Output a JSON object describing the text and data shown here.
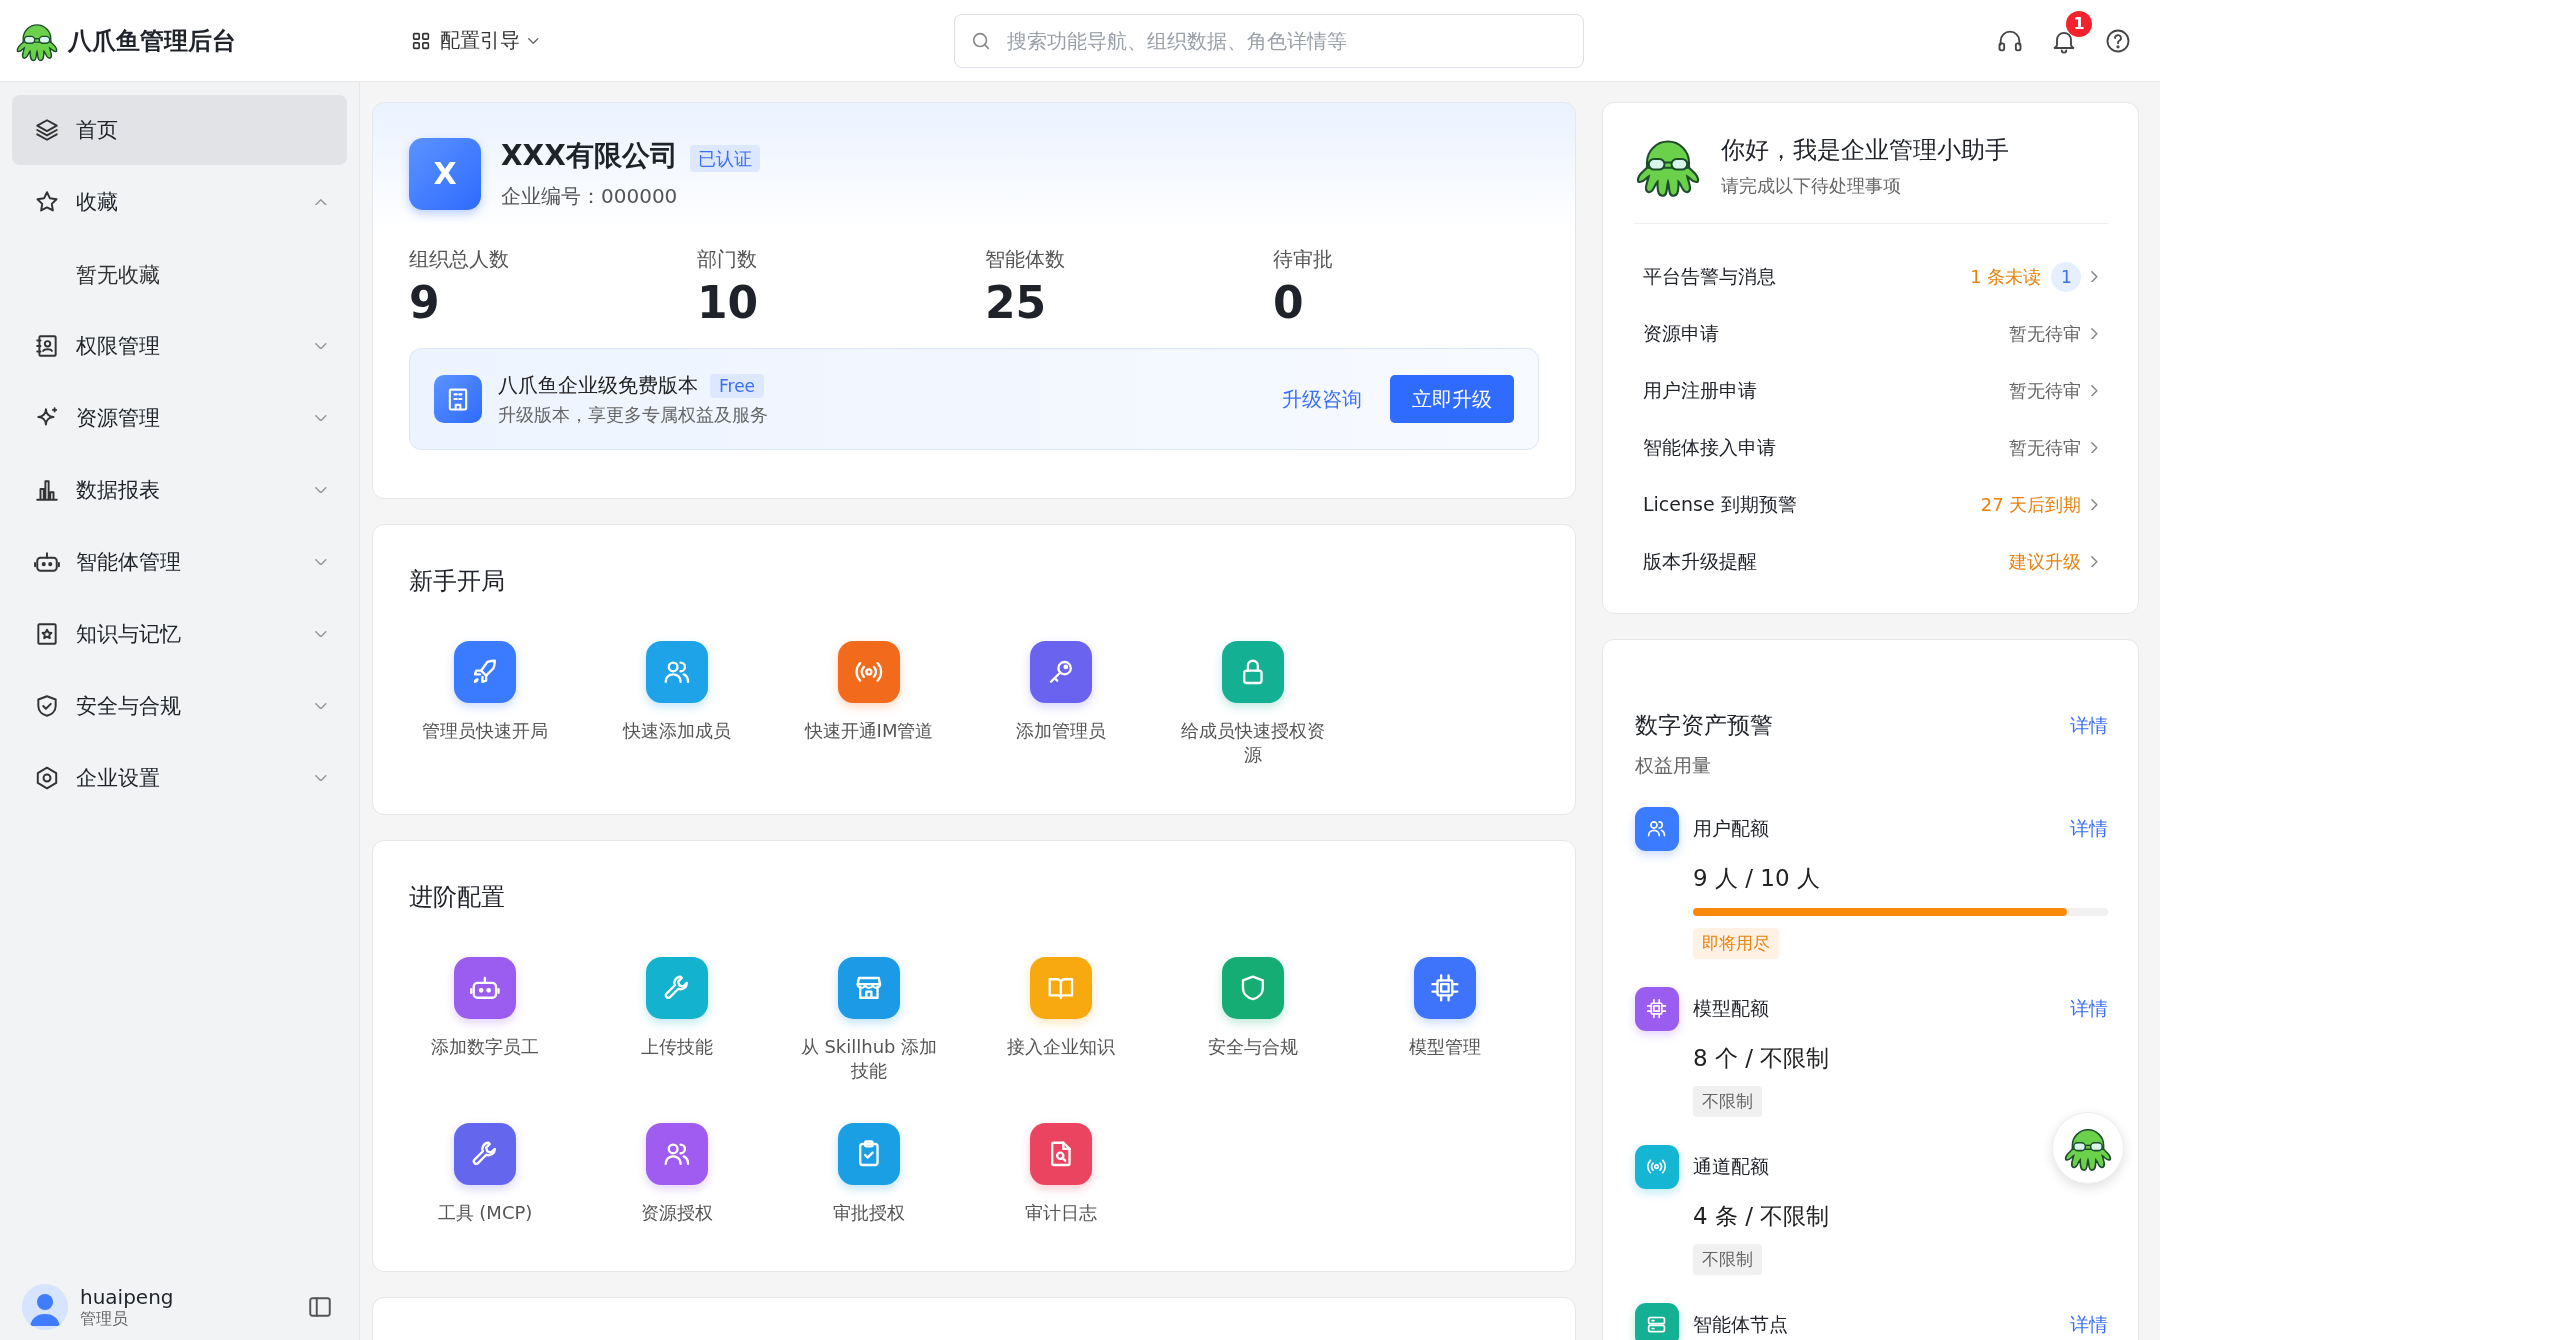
{
  "header": {
    "brand": "八爪鱼管理后台",
    "guide": "配置引导",
    "search_placeholder": "搜索功能导航、组织数据、角色详情等",
    "notification_count": "1"
  },
  "sidebar": {
    "items": [
      {
        "label": "首页",
        "selected": true
      },
      {
        "label": "收藏",
        "selected": false,
        "expanded": true,
        "empty_note": "暂无收藏"
      },
      {
        "label": "权限管理",
        "selected": false,
        "expanded": false
      },
      {
        "label": "资源管理",
        "selected": false,
        "expanded": false
      },
      {
        "label": "数据报表",
        "selected": false,
        "expanded": false
      },
      {
        "label": "智能体管理",
        "selected": false,
        "expanded": false
      },
      {
        "label": "知识与记忆",
        "selected": false,
        "expanded": false
      },
      {
        "label": "安全与合规",
        "selected": false,
        "expanded": false
      },
      {
        "label": "企业设置",
        "selected": false,
        "expanded": false
      }
    ],
    "user": {
      "name": "huaipeng",
      "role": "管理员"
    }
  },
  "company": {
    "logo": "X",
    "name": "XXX有限公司",
    "badge": "已认证",
    "code": "企业编号：000000",
    "stats": [
      {
        "label": "组织总人数",
        "value": "9"
      },
      {
        "label": "部门数",
        "value": "10"
      },
      {
        "label": "智能体数",
        "value": "25"
      },
      {
        "label": "待审批",
        "value": "0"
      }
    ],
    "plan": {
      "name": "八爪鱼企业级免费版本",
      "tag": "Free",
      "desc": "升级版本，享更多专属权益及服务",
      "link": "升级咨询",
      "button": "立即升级"
    }
  },
  "sections": [
    {
      "title": "新手开局",
      "items": [
        {
          "label": "管理员快速开局",
          "color": "#3b7bff"
        },
        {
          "label": "快速添加成员",
          "color": "#1fa3e8"
        },
        {
          "label": "快速开通IM管道",
          "color": "#f26b1d"
        },
        {
          "label": "添加管理员",
          "color": "#6a63f0"
        },
        {
          "label": "给成员快速授权资源",
          "color": "#14b094"
        }
      ]
    },
    {
      "title": "进阶配置",
      "items": [
        {
          "label": "添加数字员工",
          "color": "#9b5cf0"
        },
        {
          "label": "上传技能",
          "color": "#13b3cf"
        },
        {
          "label": "从 Skillhub 添加技能",
          "color": "#1c9ae6"
        },
        {
          "label": "接入企业知识",
          "color": "#f7a90f"
        },
        {
          "label": "安全与合规",
          "color": "#16ad74"
        },
        {
          "label": "模型管理",
          "color": "#3d74fb"
        },
        {
          "label": "工具 (MCP)",
          "color": "#6467ee"
        },
        {
          "label": "资源授权",
          "color": "#a05cf0"
        },
        {
          "label": "审批授权",
          "color": "#1a9fe5"
        },
        {
          "label": "审计日志",
          "color": "#eb4460"
        }
      ]
    }
  ],
  "assistant": {
    "title": "你好，我是企业管理小助手",
    "subtitle": "请完成以下待处理事项",
    "tasks": [
      {
        "label": "平台告警与消息",
        "status": "1 条未读",
        "kind": "warning",
        "count": "1"
      },
      {
        "label": "资源申请",
        "status": "暂无待审",
        "kind": "muted"
      },
      {
        "label": "用户注册申请",
        "status": "暂无待审",
        "kind": "muted"
      },
      {
        "label": "智能体接入申请",
        "status": "暂无待审",
        "kind": "muted"
      },
      {
        "label": "License 到期预警",
        "status": "27 天后到期",
        "kind": "warning"
      },
      {
        "label": "版本升级提醒",
        "status": "建议升级",
        "kind": "warning"
      }
    ]
  },
  "assets": {
    "title": "数字资产预警",
    "link": "详情",
    "subtitle": "权益用量",
    "quotas": [
      {
        "label": "用户配额",
        "color": "#3b7bff",
        "link": "详情",
        "usage": "9 人 / 10 人",
        "level": 0.9,
        "tag": "即将用尽",
        "kind": "warning"
      },
      {
        "label": "模型配额",
        "color": "#9b5cf0",
        "link": "详情",
        "usage": "8 个 / 不限制",
        "tag": "不限制",
        "kind": "muted"
      },
      {
        "label": "通道配额",
        "color": "#15b6d4",
        "usage": "4 条 / 不限制",
        "tag": "不限制",
        "kind": "muted"
      },
      {
        "label": "智能体节点",
        "color": "#14b094",
        "link": "详情"
      }
    ]
  }
}
